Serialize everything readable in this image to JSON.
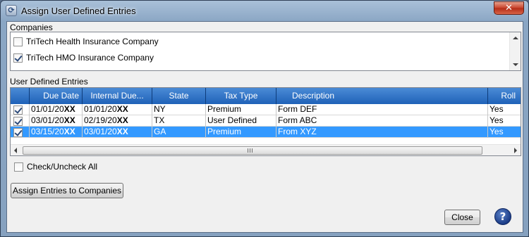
{
  "window": {
    "title": "Assign User Defined Entries",
    "close_glyph": "✕"
  },
  "companies": {
    "label": "Companies",
    "items": [
      {
        "name": "TriTech Health Insurance Company",
        "checked": false
      },
      {
        "name": "TriTech HMO Insurance Company",
        "checked": true
      }
    ]
  },
  "entries": {
    "label": "User Defined Entries",
    "columns": [
      "",
      "Due Date",
      "Internal Due...",
      "State",
      "Tax Type",
      "Description",
      "Roll"
    ],
    "rows": [
      {
        "checked": true,
        "due_date": "01/01/20",
        "due_suffix": "XX",
        "internal_due": "01/01/20",
        "internal_suffix": "XX",
        "state": "NY",
        "tax_type": "Premium",
        "description": "Form DEF",
        "roll": "Yes",
        "selected": false
      },
      {
        "checked": true,
        "due_date": "03/01/20",
        "due_suffix": "XX",
        "internal_due": "02/19/20",
        "internal_suffix": "XX",
        "state": "TX",
        "tax_type": "User Defined",
        "description": "Form ABC",
        "roll": "Yes",
        "selected": false
      },
      {
        "checked": true,
        "due_date": "03/15/20",
        "due_suffix": "XX",
        "internal_due": "03/01/20",
        "internal_suffix": "XX",
        "state": "GA",
        "tax_type": "Premium",
        "description": "From XYZ",
        "roll": "Yes",
        "selected": true
      }
    ]
  },
  "check_all": {
    "label": "Check/Uncheck All",
    "checked": false
  },
  "buttons": {
    "assign": "Assign Entries to Companies",
    "close": "Close",
    "help": "?"
  },
  "colors": {
    "header_blue": "#1f62b8",
    "selection_blue": "#3399ff"
  }
}
